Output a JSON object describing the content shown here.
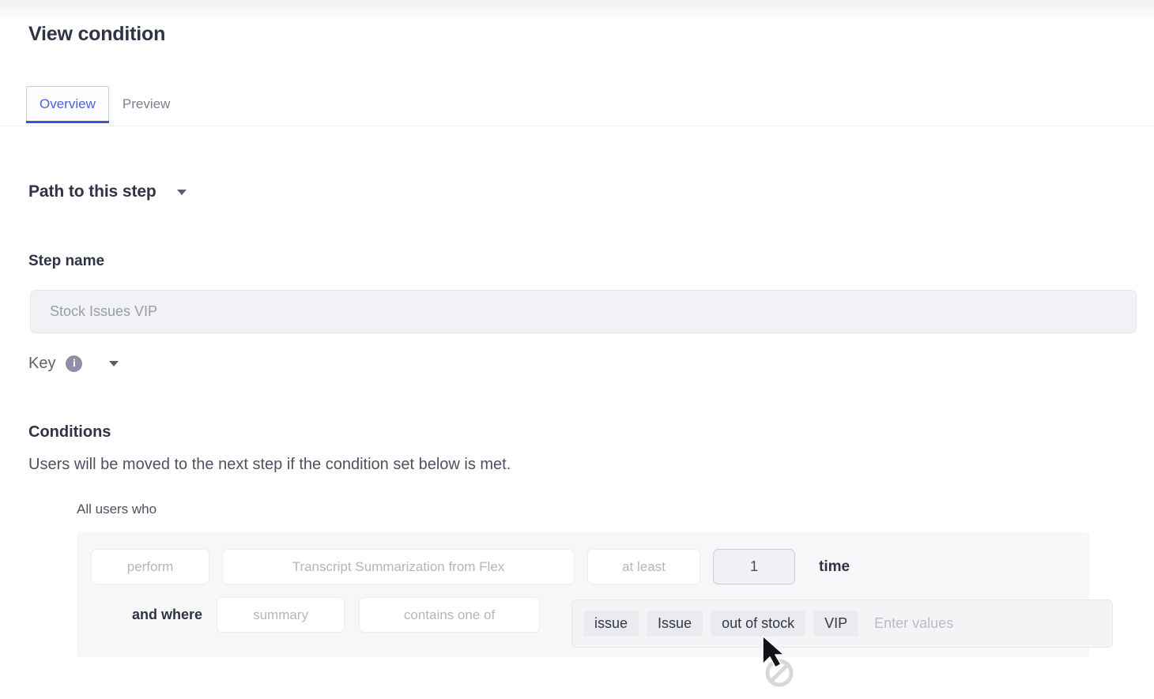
{
  "header": {
    "title": "View condition"
  },
  "tabs": {
    "items": [
      {
        "label": "Overview",
        "active": true
      },
      {
        "label": "Preview",
        "active": false
      }
    ]
  },
  "path_section": {
    "label": "Path to this step",
    "caret_icon": "chevron-down-icon"
  },
  "step_name": {
    "label": "Step name",
    "value": "",
    "placeholder": "Stock Issues VIP"
  },
  "key_section": {
    "label": "Key",
    "info_icon": "info-icon",
    "info_glyph": "i",
    "caret_icon": "chevron-down-icon"
  },
  "conditions": {
    "title": "Conditions",
    "description": "Users will be moved to the next step if the condition set below is met.",
    "group_label": "All users who",
    "row1": {
      "verb_select": "perform",
      "event_select": "Transcript Summarization from Flex",
      "operator_select": "at least",
      "count_value": "1",
      "unit_label": "time"
    },
    "row2": {
      "conjunction": "and where",
      "property_select": "summary",
      "comparator_select": "contains one of",
      "values": [
        "issue",
        "Issue",
        "out of stock",
        "VIP"
      ],
      "values_placeholder": "Enter values"
    }
  },
  "cursor": {
    "icon": "no-drop-cursor"
  },
  "colors": {
    "accent": "#3a53db",
    "tab_active_text": "#4a62e0",
    "title_text": "#2e3346",
    "placeholder_text": "#b3b6c0",
    "panel_bg": "#f7f7f9",
    "input_bg": "#f1f2f5"
  }
}
